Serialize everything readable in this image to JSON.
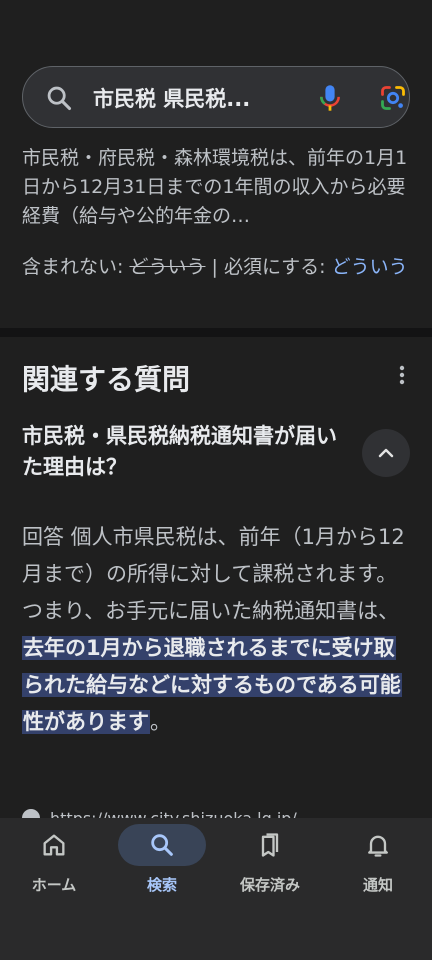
{
  "search": {
    "query": "市民税 県民税..."
  },
  "snippet": {
    "text": "市民税・府民税・森林環境税は、前年の1月1日から12月31日までの1年間の収入から必要経費（給与や公的年金の…"
  },
  "tags": {
    "excluded_label": "含まれない:",
    "excluded_term": "どういう",
    "separator": "|",
    "required_label": "必須にする:",
    "required_term": "どういう"
  },
  "related": {
    "title": "関連する質問",
    "question": "市民税・県民税納税通知書が届いた理由は？",
    "answer_plain": "回答 個人市県民税は、前年（1月から12月まで）の所得に対して課税されます。 つまり、お手元に届いた納税通知書は、",
    "answer_highlight": "去年の1月から退職されるまでに受け取られた給与などに対するものである可能性があります",
    "answer_tail": "。",
    "source_peek": "https://www.city.shizuoka.lg.jp/..."
  },
  "nav": {
    "items": [
      {
        "label": "ホーム",
        "icon": "home-icon",
        "active": false
      },
      {
        "label": "検索",
        "icon": "search-icon",
        "active": true
      },
      {
        "label": "保存済み",
        "icon": "saved-icon",
        "active": false
      },
      {
        "label": "通知",
        "icon": "bell-icon",
        "active": false
      }
    ]
  },
  "colors": {
    "background": "#1f1f1f",
    "link": "#8ab4f8",
    "highlight": "#34416b",
    "active_nav": "#a8c7fa"
  }
}
